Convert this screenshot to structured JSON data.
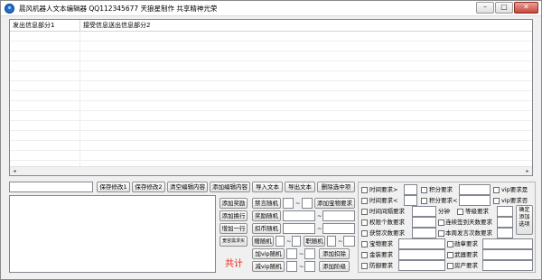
{
  "window": {
    "title": "晨风机器人文本编辑器    QQ112345677 天狼星制作   共享精神光荣",
    "minimize": "–",
    "maximize": "□",
    "close": "✕"
  },
  "list": {
    "columns": [
      "发出信息部分1",
      "接受信息送出信息部分2"
    ],
    "scroll_left": "◂",
    "scroll_right": "▸"
  },
  "toolbar": {
    "save1": "保存修改1",
    "save2": "保存修改2",
    "clear": "清空编辑内容",
    "add": "添加编辑内容",
    "import": "导入文本",
    "export": "导出文本",
    "delete": "删除选中项"
  },
  "left_buttons": {
    "add_reward": "添加奖励",
    "add_newline": "添加换行",
    "add_one_line": "增加一行",
    "other": "宽容需求买"
  },
  "total_label": "共计",
  "random": {
    "forbid_random": "禁言随机",
    "add_treasure": "添加宝物要求",
    "reward_random": "奖励随机",
    "deduct_random": "扣币随机",
    "item_random": "赠随机",
    "rank_random": "职随机",
    "add_vip_random": "加vip随机",
    "reduce_vip_random": "减vip随机",
    "add_deduct": "添加扣除",
    "add_level": "添加阶级",
    "tilde": "~"
  },
  "conditions": {
    "time_gt": "时间要求>",
    "time_lt": "时间要求<",
    "interval": "时间间隔要求",
    "minutes": "分钟",
    "points_req": "权限个数要求",
    "gain_req": "获赞次数要求",
    "score_gt": "积分要求",
    "score_lt": "积分要求<",
    "vip_is": "vip要求是",
    "vip_no": "vip要求否",
    "level_req": "等级要求",
    "consecutive": "连续签到天数要求",
    "weekly": "本周发言次数要求",
    "confirm_add": "确定添加选项",
    "treasure_req": "宝物要求",
    "rank_req": "勋章要求",
    "gold_req": "金装要求",
    "weapon_req": "武器要求",
    "armor_req": "防御要求",
    "house_req": "房产要求"
  }
}
